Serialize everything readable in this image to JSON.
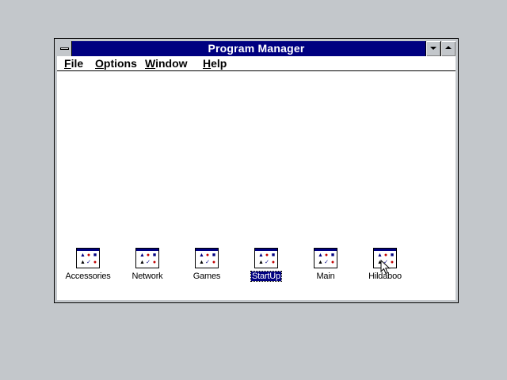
{
  "window": {
    "title": "Program Manager"
  },
  "menu": [
    {
      "label": "File"
    },
    {
      "label": "Options"
    },
    {
      "label": "Window"
    },
    {
      "label": "Help"
    }
  ],
  "groups": [
    {
      "label": "Accessories",
      "selected": false
    },
    {
      "label": "Network",
      "selected": false
    },
    {
      "label": "Games",
      "selected": false
    },
    {
      "label": "StartUp",
      "selected": true
    },
    {
      "label": "Main",
      "selected": false
    },
    {
      "label": "Hildaboo",
      "selected": false
    }
  ],
  "colors": {
    "desktop": "#c3c7cb",
    "titlebar": "#000080",
    "selection": "#000080"
  }
}
